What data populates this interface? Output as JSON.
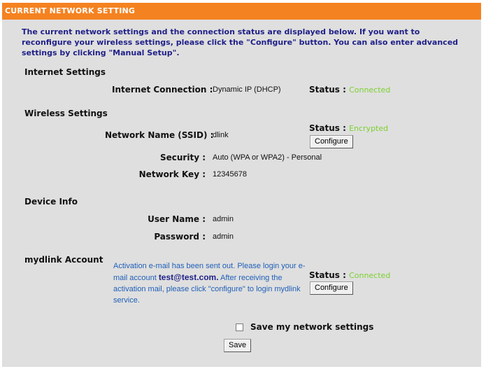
{
  "header": {
    "title": "CURRENT NETWORK SETTING"
  },
  "intro": "The current network settings and the connection status are displayed below. If you want to reconfigure your wireless settings, please click the \"Configure\" button. You can also enter advanced settings by clicking \"Manual Setup\".",
  "internet": {
    "section_title": "Internet Settings",
    "connection_label": "Internet Connection",
    "connection_value": "Dynamic IP (DHCP)",
    "status_label": "Status :",
    "status_value": "Connected"
  },
  "wireless": {
    "section_title": "Wireless Settings",
    "ssid_label": "Network Name (SSID)",
    "ssid_value": "dlink",
    "status_label": "Status :",
    "status_value": "Encrypted",
    "configure_label": "Configure",
    "security_label": "Security",
    "security_value": "Auto (WPA or WPA2) - Personal",
    "key_label": "Network Key",
    "key_value": "12345678"
  },
  "device": {
    "section_title": "Device Info",
    "user_label": "User Name",
    "user_value": "admin",
    "password_label": "Password",
    "password_value": "admin"
  },
  "mydlink": {
    "section_title": "mydlink Account",
    "msg_part1": "Activation e-mail has been sent out. Please login your e-mail account ",
    "email": "test@test.com.",
    "msg_part2": " After receiving the activation mail, please click \"configure\" to login mydlink service.",
    "status_label": "Status :",
    "status_value": "Connected",
    "configure_label": "Configure"
  },
  "save": {
    "checkbox_label": "Save my network settings",
    "button_label": "Save"
  },
  "colors": {
    "header_bg": "#f58220",
    "status_green": "#7bd12f",
    "intro_text": "#1f1f88",
    "mydlink_text": "#1f5fb8",
    "panel_bg": "#dfdfdf"
  }
}
